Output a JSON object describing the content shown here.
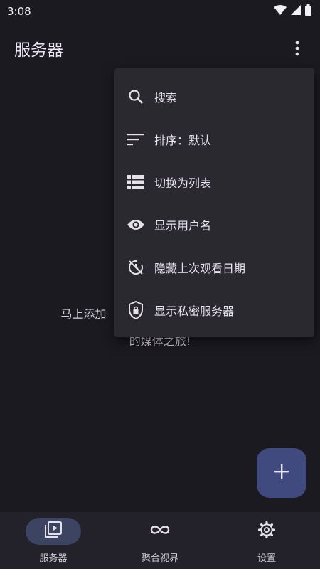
{
  "status_bar": {
    "time": "3:08",
    "icons": [
      "wifi-icon",
      "signal-icon",
      "battery-icon"
    ]
  },
  "app_bar": {
    "title": "服务器",
    "overflow_icon": "more-vert-icon"
  },
  "empty_state": {
    "line1": "马上添加",
    "line2": "的媒体之旅!"
  },
  "menu": {
    "items": [
      {
        "label": "搜索",
        "icon": "search-icon"
      },
      {
        "label": "排序：默认",
        "icon": "sort-icon"
      },
      {
        "label": "切换为列表",
        "icon": "list-icon"
      },
      {
        "label": "显示用户名",
        "icon": "eye-icon"
      },
      {
        "label": "隐藏上次观看日期",
        "icon": "history-off-icon"
      },
      {
        "label": "显示私密服务器",
        "icon": "shield-lock-icon"
      }
    ]
  },
  "fab": {
    "icon": "plus-icon"
  },
  "bottom_nav": {
    "items": [
      {
        "label": "服务器",
        "icon": "video-library-icon",
        "active": true
      },
      {
        "label": "聚合视界",
        "icon": "infinity-icon",
        "active": false
      },
      {
        "label": "设置",
        "icon": "gear-icon",
        "active": false
      }
    ]
  },
  "colors": {
    "background": "#1b1a20",
    "menu": "#2a2930",
    "fab": "#414a7e",
    "nav_active": "#3c4462"
  }
}
